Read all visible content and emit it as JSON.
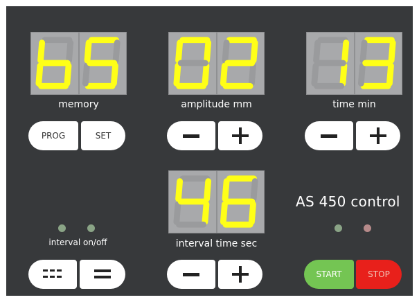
{
  "displays": {
    "memory": {
      "digits": [
        "b",
        "5"
      ],
      "label": "memory"
    },
    "amplitude": {
      "digits": [
        "0",
        "2"
      ],
      "label": "amplitude mm"
    },
    "time": {
      "digits": [
        "1",
        "3"
      ],
      "label": "time min"
    },
    "interval_time": {
      "digits": [
        "4",
        "6"
      ],
      "label": "interval time sec"
    }
  },
  "buttons": {
    "prog": "PROG",
    "set": "SET",
    "start": "START",
    "stop": "STOP"
  },
  "interval_label": "interval on/off",
  "device_title": "AS 450 control",
  "colors": {
    "panel": "#37393b",
    "display_bg": "#a8a9ab",
    "segment_on": "#ffff17",
    "segment_off": "#9a9b9d",
    "start_green": "#74c553",
    "stop_red": "#e8201b"
  },
  "icons": [
    "minus-icon",
    "plus-icon",
    "dotted-lines-icon",
    "equals-icon"
  ]
}
